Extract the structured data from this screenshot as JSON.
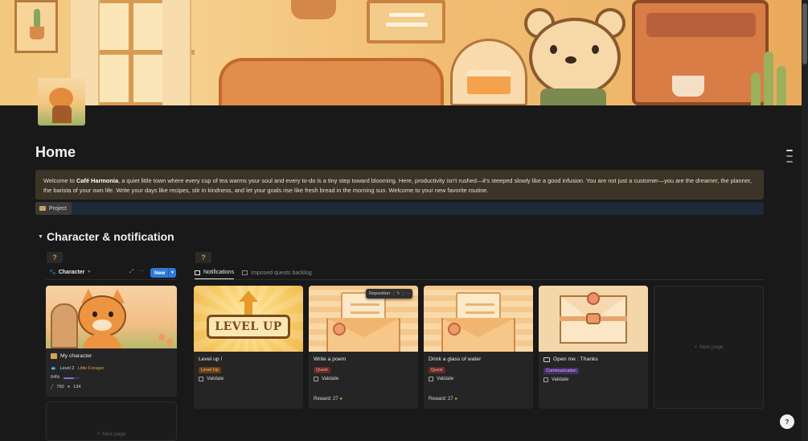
{
  "page": {
    "title": "Home"
  },
  "callout": {
    "lead": "Welcome to ",
    "bold": "Café Harmonia",
    "rest": ", a quiet little town where every cup of tea warms your soul and every to-do is a tiny step toward blooming. Here, productivity isn't rushed—it's steeped slowly like a good infusion. You are not just a customer—you are the dreamer, the planner, the barista of your own life. Write your days like recipes, stir in kindness, and let your goals rise like fresh bread in the morning sun. Welcome to your new favorite routine."
  },
  "project_button": {
    "label": "Project",
    "icon": "folder-icon"
  },
  "section": {
    "toggle": "▼",
    "title": "Character & notification"
  },
  "placeholders": {
    "question": "?"
  },
  "character_view": {
    "tab_label": "Character",
    "new_button": "New",
    "card": {
      "title": "My character",
      "level_prefix": "Level 2",
      "level_name": "Little Forager",
      "progress_text": "64%",
      "progress_value": 0.64,
      "stat_a": "750",
      "stat_b": "134"
    },
    "new_page_label": "New page"
  },
  "notifications_view": {
    "tabs": [
      {
        "label": "Notifications",
        "active": true
      },
      {
        "label": "Imposed quests backlog",
        "active": false
      }
    ],
    "hover_menu": {
      "reposition_label": "Reposition"
    },
    "cards": [
      {
        "title": "Level up !",
        "tag": "Level Up",
        "check_label": "Validate",
        "reward": ""
      },
      {
        "title": "Write a poem",
        "tag": "Quest",
        "check_label": "Validate",
        "reward": "Reward: 27"
      },
      {
        "title": "Drink a glass of water",
        "tag": "Quest",
        "check_label": "Validate",
        "reward": "Reward: 27"
      },
      {
        "title": "Open me : Thanks",
        "tag": "Communication",
        "check_label": "Validate",
        "reward": ""
      }
    ],
    "new_page_label": "New page",
    "levelup_banner": "LEVEL UP"
  },
  "colors": {
    "accent_blue": "#2f7ad8",
    "question_orange": "#e58a2e",
    "callout_bg": "#3c3426",
    "progress_purple": "#8f6bd6"
  },
  "help": {
    "label": "?"
  }
}
